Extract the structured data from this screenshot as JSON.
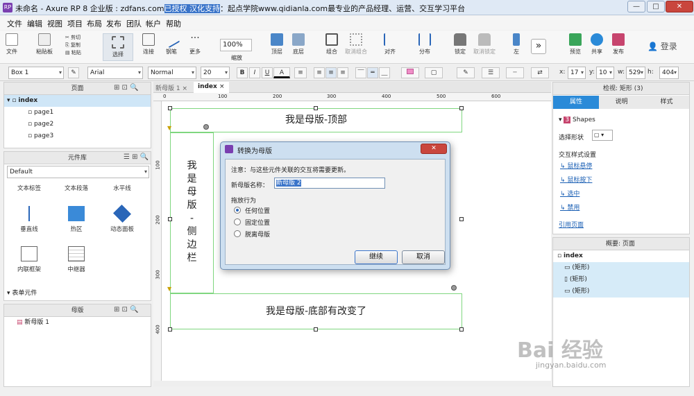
{
  "window": {
    "title_prefix": "未命名 - Axure RP 8 企业版 : zdfans.com",
    "title_highlight": "已授权 汉化支持",
    "title_suffix": "：起点学院www.qidianla.com最专业的产品经理、运营、交互学习平台",
    "app_icon": "RP"
  },
  "menu": [
    "文件",
    "编辑",
    "视图",
    "项目",
    "布局",
    "发布",
    "团队",
    "帐户",
    "帮助"
  ],
  "toolbar": {
    "file": "文件",
    "paste": "粘贴板",
    "cut": "剪切",
    "copy": "复制",
    "paste_small": "粘贴",
    "select": "选择",
    "connect": "连接",
    "pen": "钢笔",
    "more": "更多",
    "zoom": "100%",
    "zoom_label": "缩放",
    "top": "顶层",
    "bottom": "底层",
    "group": "组合",
    "ungroup": "取消组合",
    "align": "对齐",
    "distribute": "分布",
    "lock": "锁定",
    "unlock": "取消锁定",
    "left": "左",
    "preview": "预览",
    "share": "共享",
    "publish": "发布",
    "login": "登录"
  },
  "format": {
    "widget": "Box 1",
    "font": "Arial",
    "style": "Normal",
    "size": "20",
    "x_label": "x:",
    "x": "17",
    "y_label": "y:",
    "y": "10",
    "w_label": "w:",
    "w": "529",
    "h_label": "h:",
    "h": "404"
  },
  "pages": {
    "title": "页面",
    "root": "index",
    "items": [
      "page1",
      "page2",
      "page3"
    ]
  },
  "library": {
    "title": "元件库",
    "selected": "Default",
    "items": [
      "文本标签",
      "文本段落",
      "水平线",
      "垂直线",
      "热区",
      "动态面板",
      "内联框架",
      "中继器"
    ],
    "section": "表单元件"
  },
  "masters": {
    "title": "母版",
    "items": [
      "新母版 1"
    ]
  },
  "tabs": [
    "新母版 1",
    "index"
  ],
  "ruler": [
    "0",
    "100",
    "200",
    "300",
    "400",
    "500",
    "600"
  ],
  "vruler": [
    "100",
    "200",
    "300",
    "400"
  ],
  "canvas": {
    "top": "我是母版-顶部",
    "side": "我\n是\n母\n版\n-\n侧\n边\n栏",
    "bottom": "我是母版-底部有改变了"
  },
  "dialog": {
    "title": "转换为母版",
    "note": "注意：与这些元件关联的交互将需要更新。",
    "name_label": "新母版名称：",
    "name_value": "新母版 2",
    "drag_label": "拖放行为",
    "options": [
      "任何位置",
      "固定位置",
      "脱离母版"
    ],
    "ok": "继续",
    "cancel": "取消"
  },
  "inspector": {
    "title": "检视: 矩形 (3)",
    "tabs": [
      "属性",
      "说明",
      "样式"
    ],
    "shapes_count": "3",
    "shapes": "Shapes",
    "shape_select": "选择形状",
    "interaction": "交互样式设置",
    "links": [
      "鼠标悬停",
      "鼠标按下",
      "选中",
      "禁用"
    ],
    "ref": "引用页面"
  },
  "outline": {
    "title": "概要: 页面",
    "root": "index",
    "items": [
      "(矩形)",
      "(矩形)",
      "(矩形)"
    ]
  },
  "watermark": "Bai 经验",
  "watermark_url": "jingyan.baidu.com"
}
